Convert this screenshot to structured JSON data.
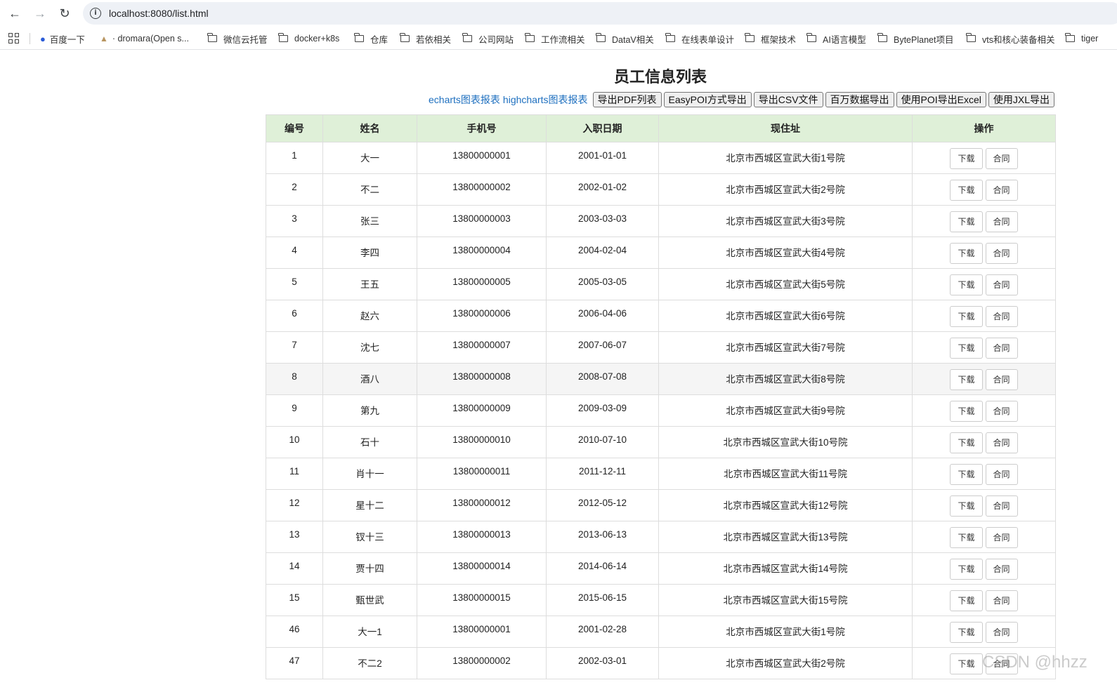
{
  "browser": {
    "url": "localhost:8080/list.html",
    "bookmarks": [
      {
        "label": "百度一下",
        "icon": "paw-icon"
      },
      {
        "label": "· dromara(Open s...",
        "icon": "dromara-icon"
      },
      {
        "label": "微信云托管",
        "icon": "folder-icon"
      },
      {
        "label": "docker+k8s",
        "icon": "folder-icon"
      },
      {
        "label": "仓库",
        "icon": "folder-icon"
      },
      {
        "label": "若依相关",
        "icon": "folder-icon"
      },
      {
        "label": "公司网站",
        "icon": "folder-icon"
      },
      {
        "label": "工作流相关",
        "icon": "folder-icon"
      },
      {
        "label": "DataV相关",
        "icon": "folder-icon"
      },
      {
        "label": "在线表单设计",
        "icon": "folder-icon"
      },
      {
        "label": "框架技术",
        "icon": "folder-icon"
      },
      {
        "label": "AI语言模型",
        "icon": "folder-icon"
      },
      {
        "label": "BytePlanet项目",
        "icon": "folder-icon"
      },
      {
        "label": "vts和核心装备相关",
        "icon": "folder-icon"
      },
      {
        "label": "tiger",
        "icon": "folder-icon"
      }
    ]
  },
  "page": {
    "title": "员工信息列表",
    "links": [
      "echarts图表报表",
      "highcharts图表报表"
    ],
    "buttons": [
      "导出PDF列表",
      "EasyPOI方式导出",
      "导出CSV文件",
      "百万数据导出",
      "使用POI导出Excel",
      "使用JXL导出"
    ]
  },
  "table": {
    "headers": [
      "编号",
      "姓名",
      "手机号",
      "入职日期",
      "现住址",
      "操作"
    ],
    "action_labels": {
      "download": "下载",
      "contract": "合同"
    },
    "rows": [
      [
        "1",
        "大一",
        "13800000001",
        "2001-01-01",
        "北京市西城区宣武大街1号院"
      ],
      [
        "2",
        "不二",
        "13800000002",
        "2002-01-02",
        "北京市西城区宣武大街2号院"
      ],
      [
        "3",
        "张三",
        "13800000003",
        "2003-03-03",
        "北京市西城区宣武大街3号院"
      ],
      [
        "4",
        "李四",
        "13800000004",
        "2004-02-04",
        "北京市西城区宣武大街4号院"
      ],
      [
        "5",
        "王五",
        "13800000005",
        "2005-03-05",
        "北京市西城区宣武大街5号院"
      ],
      [
        "6",
        "赵六",
        "13800000006",
        "2006-04-06",
        "北京市西城区宣武大街6号院"
      ],
      [
        "7",
        "沈七",
        "13800000007",
        "2007-06-07",
        "北京市西城区宣武大街7号院"
      ],
      [
        "8",
        "酒八",
        "13800000008",
        "2008-07-08",
        "北京市西城区宣武大街8号院"
      ],
      [
        "9",
        "第九",
        "13800000009",
        "2009-03-09",
        "北京市西城区宣武大街9号院"
      ],
      [
        "10",
        "石十",
        "13800000010",
        "2010-07-10",
        "北京市西城区宣武大街10号院"
      ],
      [
        "11",
        "肖十一",
        "13800000011",
        "2011-12-11",
        "北京市西城区宣武大街11号院"
      ],
      [
        "12",
        "星十二",
        "13800000012",
        "2012-05-12",
        "北京市西城区宣武大街12号院"
      ],
      [
        "13",
        "钗十三",
        "13800000013",
        "2013-06-13",
        "北京市西城区宣武大街13号院"
      ],
      [
        "14",
        "贾十四",
        "13800000014",
        "2014-06-14",
        "北京市西城区宣武大街14号院"
      ],
      [
        "15",
        "甄世武",
        "13800000015",
        "2015-06-15",
        "北京市西城区宣武大街15号院"
      ],
      [
        "46",
        "大一1",
        "13800000001",
        "2001-02-28",
        "北京市西城区宣武大街1号院"
      ],
      [
        "47",
        "不二2",
        "13800000002",
        "2002-03-01",
        "北京市西城区宣武大街2号院"
      ]
    ],
    "highlighted_row": "8"
  },
  "watermark": "CSDN @hhzz"
}
